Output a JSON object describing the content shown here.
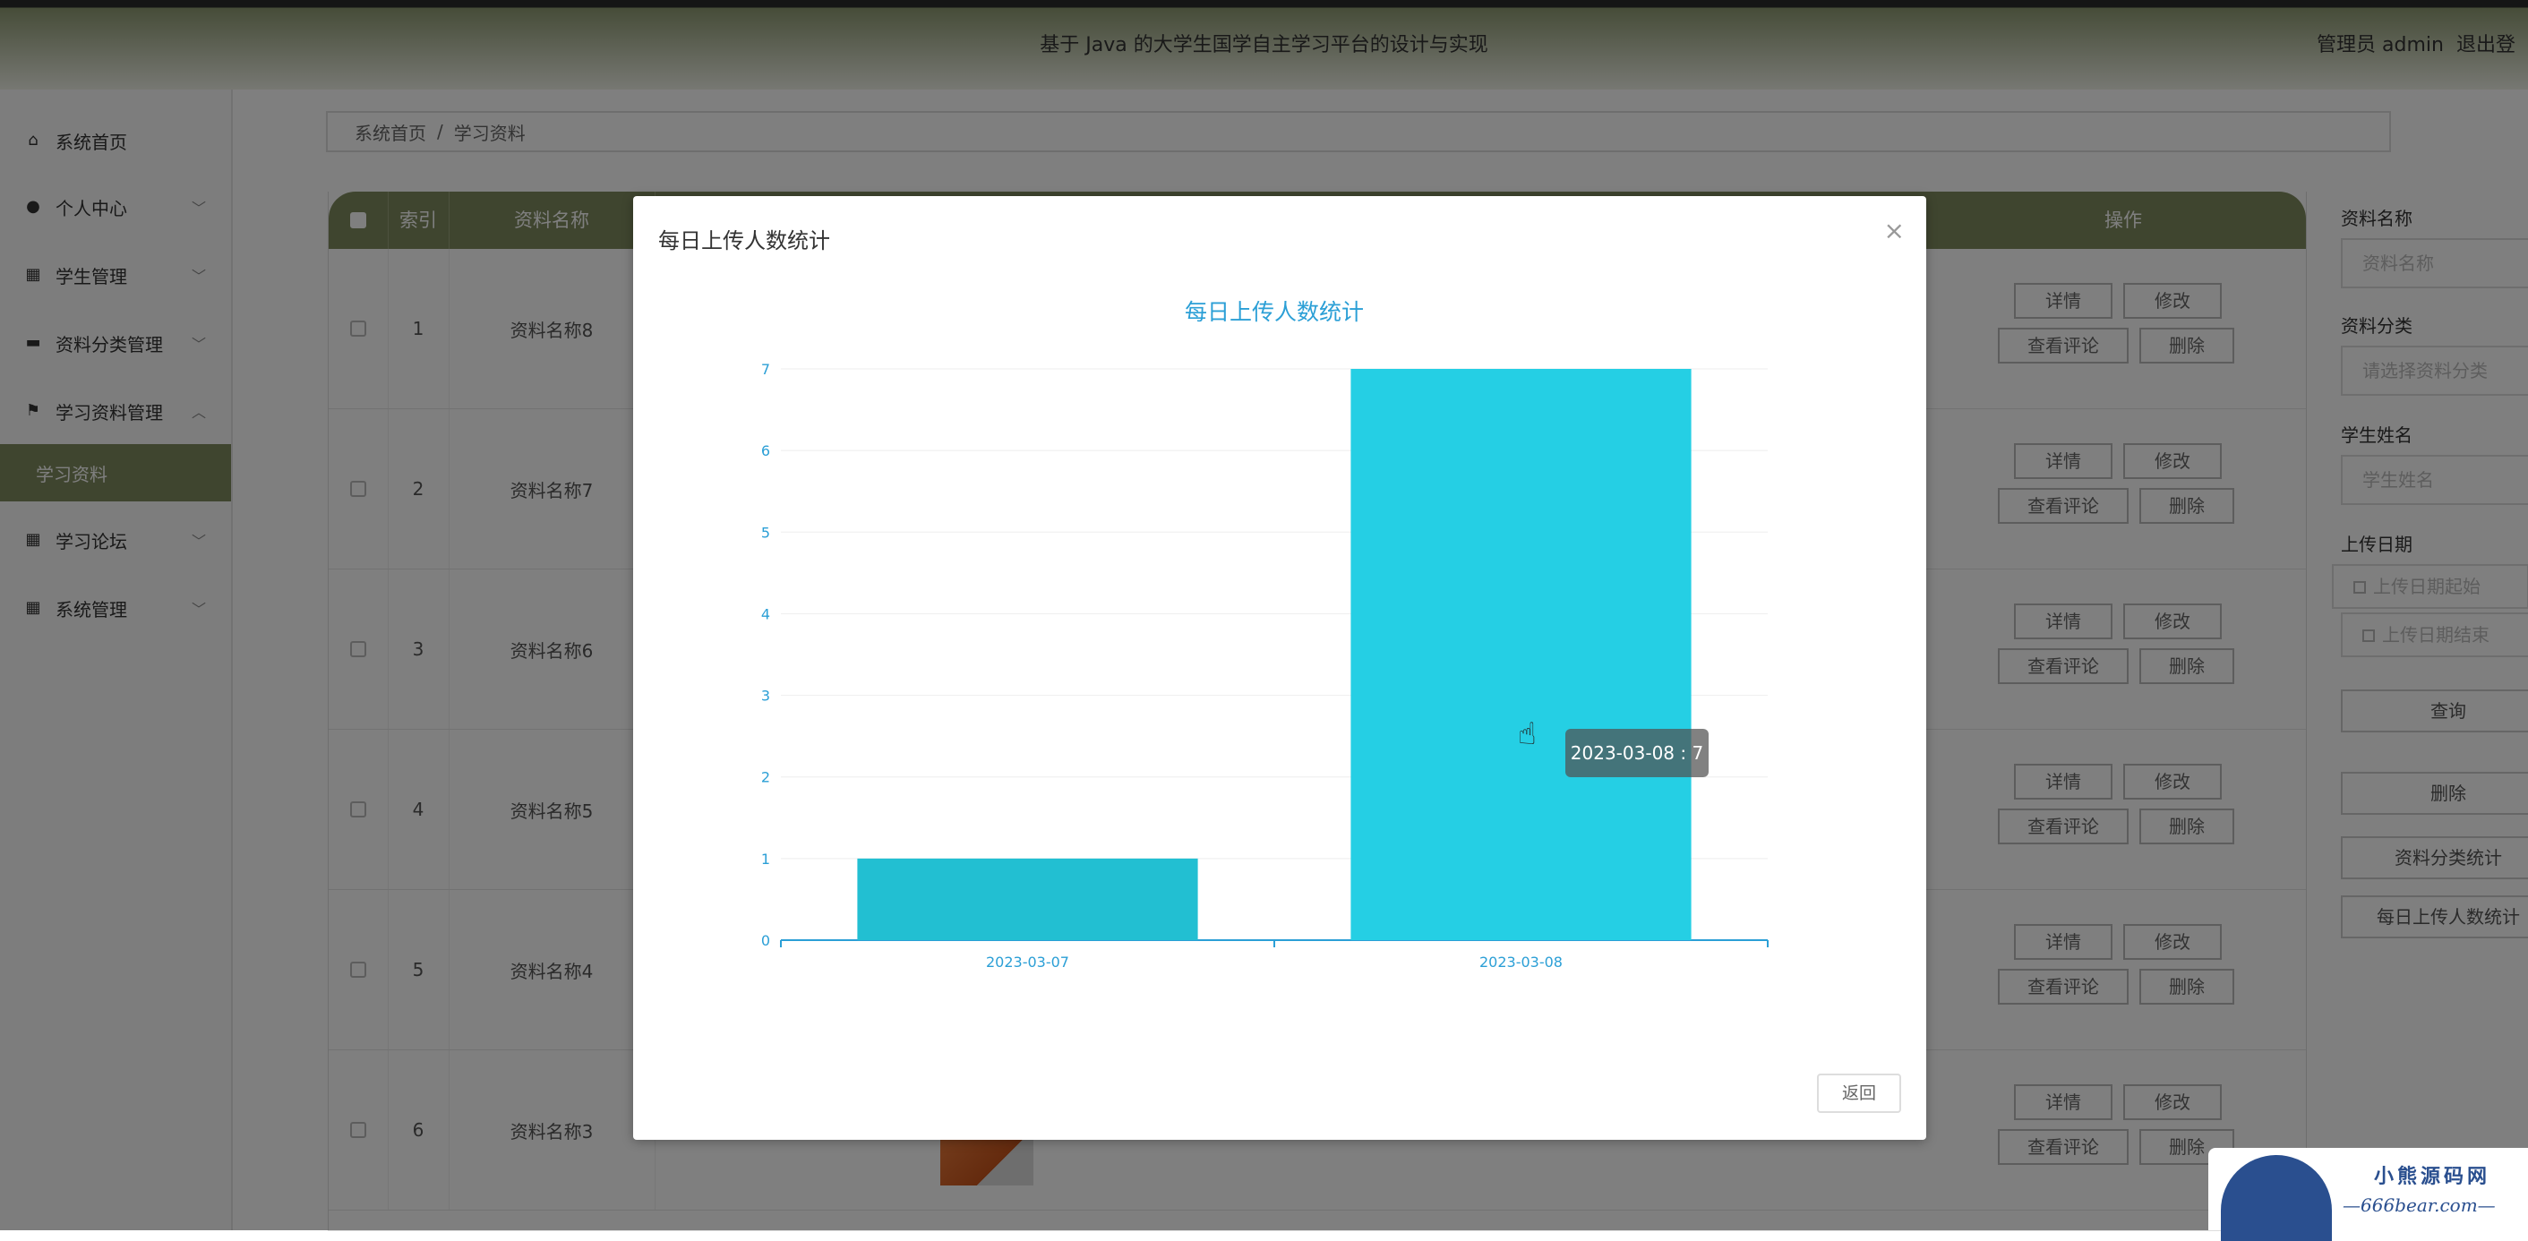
{
  "header": {
    "title": "基于 Java 的大学生国学自主学习平台的设计与实现",
    "user": "管理员 admin",
    "logout": "退出登"
  },
  "sidebar": {
    "items": [
      {
        "label": "系统首页",
        "icon": "home-icon"
      },
      {
        "label": "个人中心",
        "icon": "user-icon"
      },
      {
        "label": "学生管理",
        "icon": "grid-icon"
      },
      {
        "label": "资料分类管理",
        "icon": "briefcase-icon"
      },
      {
        "label": "学习资料管理",
        "icon": "flag-icon"
      },
      {
        "label": "学习论坛",
        "icon": "grid-icon"
      },
      {
        "label": "系统管理",
        "icon": "grid-icon"
      }
    ],
    "active_sub": "学习资料",
    "active_color": "#7e8a5e"
  },
  "breadcrumb": {
    "home": "系统首页",
    "sep": "/",
    "current": "学习资料"
  },
  "table": {
    "headers": {
      "index": "索引",
      "name": "资料名称",
      "ops": "操作"
    },
    "rows": [
      {
        "index": "1",
        "name": "资料名称8"
      },
      {
        "index": "2",
        "name": "资料名称7"
      },
      {
        "index": "3",
        "name": "资料名称6"
      },
      {
        "index": "4",
        "name": "资料名称5"
      },
      {
        "index": "5",
        "name": "资料名称4"
      },
      {
        "index": "6",
        "name": "资料名称3"
      }
    ],
    "buttons": {
      "detail": "详情",
      "edit": "修改",
      "comments": "查看评论",
      "delete": "删除"
    }
  },
  "search": {
    "name_label": "资料名称",
    "name_placeholder": "资料名称",
    "category_label": "资料分类",
    "category_placeholder": "请选择资料分类",
    "student_label": "学生姓名",
    "student_placeholder": "学生姓名",
    "date_label": "上传日期",
    "date_start": "上传日期起始",
    "date_end": "上传日期结束",
    "query": "查询",
    "delete": "删除",
    "category_stats": "资料分类统计",
    "daily_stats": "每日上传人数统计"
  },
  "modal": {
    "title": "每日上传人数统计",
    "close": "×",
    "return": "返回",
    "tooltip": "2023-03-08 : 7"
  },
  "chart_data": {
    "type": "bar",
    "title": "每日上传人数统计",
    "categories": [
      "2023-03-07",
      "2023-03-08"
    ],
    "values": [
      1,
      7
    ],
    "ylim": [
      0,
      7
    ],
    "yticks": [
      "0",
      "1",
      "2",
      "3",
      "4",
      "5",
      "6",
      "7"
    ],
    "xlabel": "",
    "ylabel": "",
    "grid": true,
    "bar_colors": [
      "#22bfd2",
      "#25cfe4"
    ],
    "axis_color": "#2b9fd6"
  },
  "watermark": {
    "line1": "小熊源码网",
    "line2": "—666bear.com—"
  }
}
